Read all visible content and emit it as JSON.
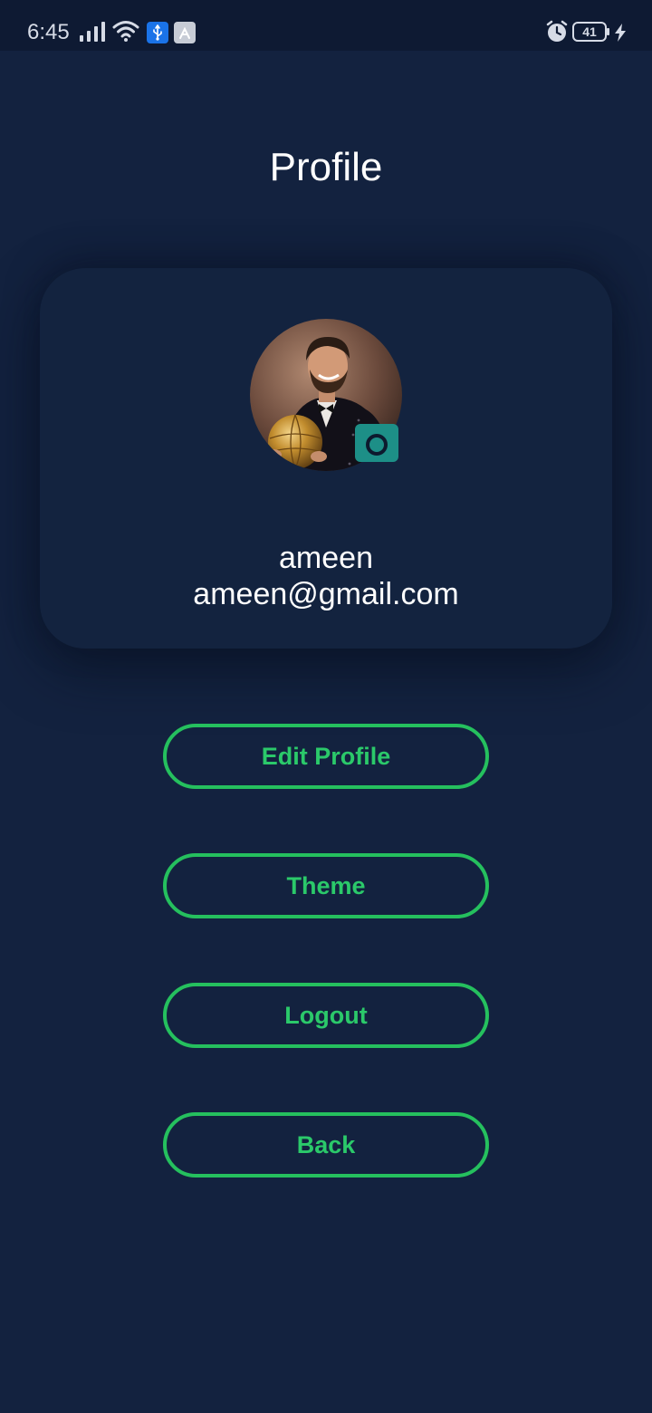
{
  "status_bar": {
    "time": "6:45",
    "battery_level": "41",
    "icons": [
      "signal-icon",
      "wifi-icon",
      "usb-icon",
      "app-store-icon",
      "alarm-icon",
      "battery-icon",
      "charging-icon"
    ]
  },
  "header": {
    "title": "Profile"
  },
  "profile": {
    "name": "ameen",
    "email": "ameen@gmail.com",
    "avatar_icon": "avatar-photo",
    "camera_icon": "camera-icon"
  },
  "actions": {
    "edit_profile": "Edit Profile",
    "theme": "Theme",
    "logout": "Logout",
    "back": "Back"
  },
  "colors": {
    "background": "#13223f",
    "status_bar": "#0e1a33",
    "accent_green": "#25c05e",
    "camera_teal": "#1d8f87",
    "text": "#ffffff"
  }
}
